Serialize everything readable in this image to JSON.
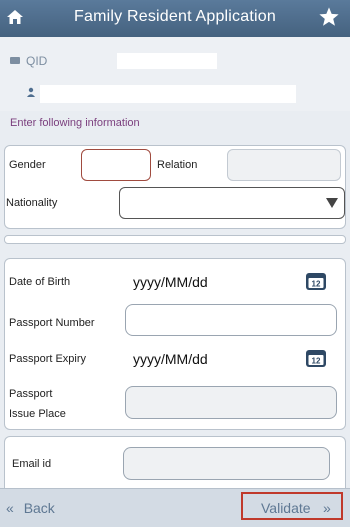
{
  "header": {
    "title": "Family Resident Application"
  },
  "identity": {
    "qid_label": "QID",
    "qid_value": "",
    "name_value": ""
  },
  "prompt": "Enter following information",
  "section1": {
    "gender_label": "Gender",
    "gender_value": "",
    "relation_label": "Relation",
    "relation_value": "",
    "nationality_label": "Nationality",
    "nationality_value": ""
  },
  "section2": {
    "dob_label": "Date of Birth",
    "dob_value": "yyyy/MM/dd",
    "passport_number_label": "Passport Number",
    "passport_number_value": "",
    "passport_expiry_label": "Passport Expiry",
    "passport_expiry_value": "yyyy/MM/dd",
    "passport_issue_label_line1": "Passport",
    "passport_issue_label_line2": "Issue Place",
    "passport_issue_value": ""
  },
  "section3": {
    "email_label": "Email id",
    "email_value": ""
  },
  "footer": {
    "back_label": "Back",
    "validate_label": "Validate"
  },
  "icons": {
    "home": "home-icon",
    "star": "star-icon",
    "calendar": "calendar-icon",
    "dropdown": "dropdown-arrow-icon"
  },
  "colors": {
    "header": "#4f6e8f",
    "accent_purple": "#7b3f7e",
    "validate_highlight": "#c0392b",
    "gender_field_border": "#a04b3f"
  }
}
